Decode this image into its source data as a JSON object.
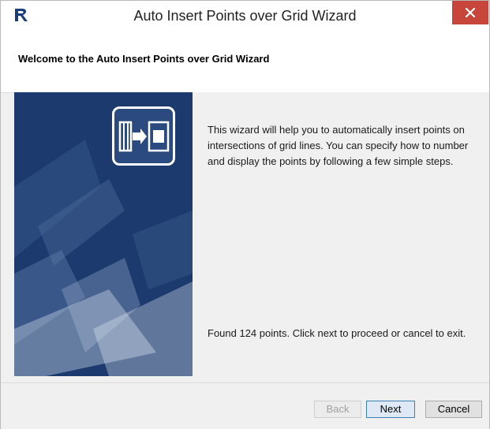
{
  "window": {
    "title": "Auto Insert Points over Grid Wizard",
    "icons": {
      "app": "revit-app-icon",
      "close": "close-icon"
    },
    "colors": {
      "close": "#c7453a",
      "banner": "#1c3a6e"
    }
  },
  "header": {
    "title": "Welcome to the Auto Insert Points over Grid Wizard"
  },
  "banner": {
    "icon": "insert-points-icon"
  },
  "content": {
    "intro": "This wizard will help you to automatically insert points on intersections of grid lines. You can specify how to number and display the points by following a few simple steps.",
    "status": "Found 124 points. Click next to proceed or cancel to exit."
  },
  "footer": {
    "back_label": "Back",
    "next_label": "Next",
    "cancel_label": "Cancel"
  }
}
